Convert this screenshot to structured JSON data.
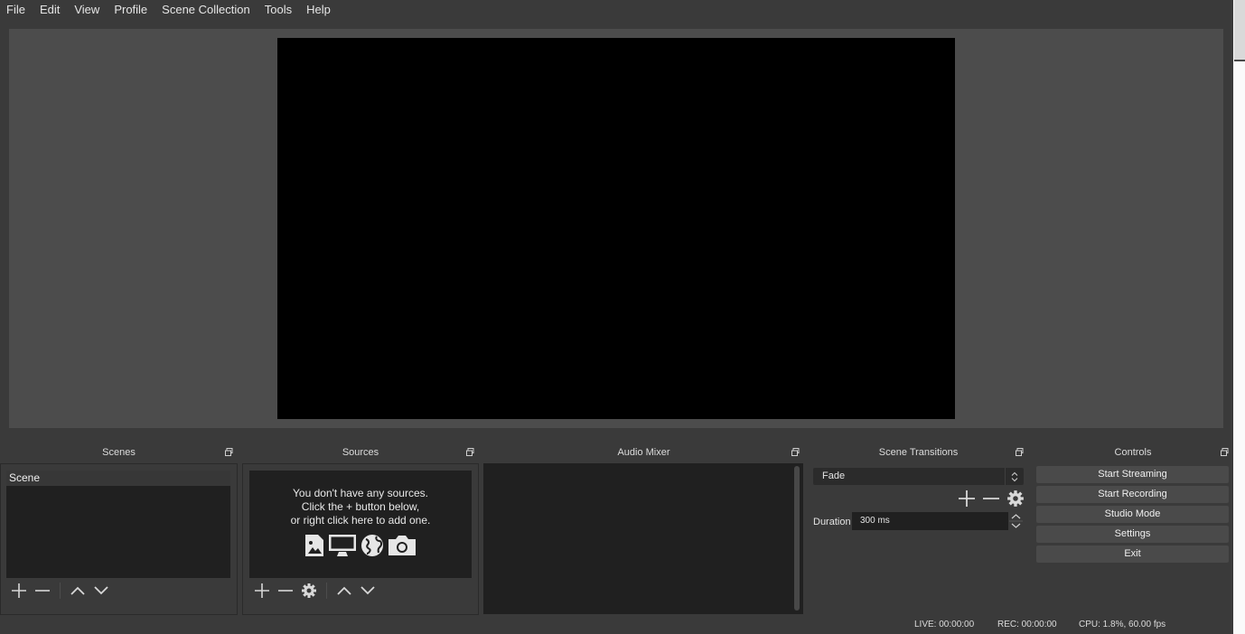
{
  "menu": [
    "File",
    "Edit",
    "View",
    "Profile",
    "Scene Collection",
    "Tools",
    "Help"
  ],
  "docks": {
    "scenes": {
      "title": "Scenes",
      "items": [
        "Scene"
      ]
    },
    "sources": {
      "title": "Sources",
      "empty_line1": "You don't have any sources.",
      "empty_line2": "Click the + button below,",
      "empty_line3": "or right click here to add one."
    },
    "mixer": {
      "title": "Audio Mixer"
    },
    "transitions": {
      "title": "Scene Transitions",
      "selected": "Fade",
      "duration_label": "Duration",
      "duration_value": "300 ms"
    },
    "controls": {
      "title": "Controls",
      "start_streaming": "Start Streaming",
      "start_recording": "Start Recording",
      "studio_mode": "Studio Mode",
      "settings": "Settings",
      "exit": "Exit"
    }
  },
  "status": {
    "live": "LIVE: 00:00:00",
    "rec": "REC: 00:00:00",
    "cpu": "CPU: 1.8%, 60.00 fps"
  },
  "icons": {
    "add": "plus-icon",
    "remove": "minus-icon",
    "properties": "gear-icon",
    "move_up": "chevron-up-icon",
    "move_down": "chevron-down-icon",
    "float": "float-dock-icon",
    "source_types": [
      "image-icon",
      "monitor-icon",
      "globe-icon",
      "camera-icon"
    ]
  },
  "colors": {
    "window_bg": "#3a3a3a",
    "panel_bg": "#202020",
    "preview_bg": "#4c4c4c",
    "canvas": "#000000",
    "button_bg": "#4a4a4a"
  }
}
